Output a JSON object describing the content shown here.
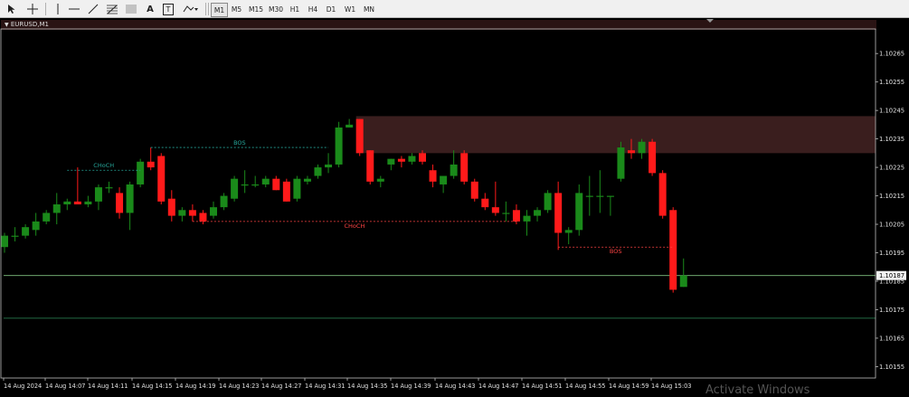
{
  "toolbar": {
    "tools": [
      "cursor-icon",
      "crosshair-icon",
      "vertical-line-icon",
      "horizontal-line-icon",
      "trendline-icon",
      "fibonacci-icon",
      "fib-channel-icon",
      "text-label-icon",
      "text-box-icon",
      "shapes-dropdown-icon"
    ],
    "labels": {
      "text_tool": "A",
      "text_box": "T"
    },
    "timeframes": [
      "M1",
      "M5",
      "M15",
      "M30",
      "H1",
      "H4",
      "D1",
      "W1",
      "MN"
    ]
  },
  "chart": {
    "symbol": "EURUSD,M1",
    "current_price": "1.10187",
    "watermark": "Activate Windows",
    "colors": {
      "bull": "#1a8a1a",
      "bear": "#ff1a1a",
      "zone": "#3a1e1e",
      "header": "#2a1414",
      "axis": "#c0c0c0",
      "price_line": "#7fbf7f",
      "choch_bull": "#26a69a",
      "choch_bear": "#ff4444"
    }
  },
  "chart_data": {
    "type": "candlestick",
    "y_ticks": [
      "1.10265",
      "1.10255",
      "1.10245",
      "1.10235",
      "1.10225",
      "1.10215",
      "1.10205",
      "1.10195",
      "1.10185",
      "1.10175",
      "1.10165",
      "1.10155"
    ],
    "x_ticks": [
      "14 Aug 2024",
      "14 Aug 14:07",
      "14 Aug 14:11",
      "14 Aug 14:15",
      "14 Aug 14:19",
      "14 Aug 14:23",
      "14 Aug 14:27",
      "14 Aug 14:31",
      "14 Aug 14:35",
      "14 Aug 14:39",
      "14 Aug 14:43",
      "14 Aug 14:47",
      "14 Aug 14:51",
      "14 Aug 14:55",
      "14 Aug 14:59",
      "14 Aug 15:03"
    ],
    "ylim": [
      1.10151,
      1.10273
    ],
    "candles": [
      {
        "o": 1.10197,
        "h": 1.10202,
        "l": 1.10195,
        "c": 1.10201
      },
      {
        "o": 1.10201,
        "h": 1.10204,
        "l": 1.10199,
        "c": 1.10201
      },
      {
        "o": 1.10201,
        "h": 1.10205,
        "l": 1.102,
        "c": 1.10204
      },
      {
        "o": 1.10203,
        "h": 1.10209,
        "l": 1.10201,
        "c": 1.10206
      },
      {
        "o": 1.10206,
        "h": 1.1021,
        "l": 1.10205,
        "c": 1.10209
      },
      {
        "o": 1.10209,
        "h": 1.10216,
        "l": 1.10205,
        "c": 1.10212
      },
      {
        "o": 1.10212,
        "h": 1.10214,
        "l": 1.1021,
        "c": 1.10213
      },
      {
        "o": 1.10213,
        "h": 1.10225,
        "l": 1.10212,
        "c": 1.10212
      },
      {
        "o": 1.10212,
        "h": 1.10215,
        "l": 1.10211,
        "c": 1.10213
      },
      {
        "o": 1.10213,
        "h": 1.10219,
        "l": 1.1021,
        "c": 1.10218
      },
      {
        "o": 1.10218,
        "h": 1.1022,
        "l": 1.10216,
        "c": 1.10218
      },
      {
        "o": 1.10216,
        "h": 1.10218,
        "l": 1.10207,
        "c": 1.10209
      },
      {
        "o": 1.10209,
        "h": 1.1022,
        "l": 1.10203,
        "c": 1.10219
      },
      {
        "o": 1.10219,
        "h": 1.10228,
        "l": 1.10218,
        "c": 1.10227
      },
      {
        "o": 1.10227,
        "h": 1.10232,
        "l": 1.10224,
        "c": 1.10225
      },
      {
        "o": 1.10229,
        "h": 1.1023,
        "l": 1.10212,
        "c": 1.10213
      },
      {
        "o": 1.10214,
        "h": 1.10217,
        "l": 1.10206,
        "c": 1.10208
      },
      {
        "o": 1.10208,
        "h": 1.10211,
        "l": 1.10206,
        "c": 1.1021
      },
      {
        "o": 1.1021,
        "h": 1.10212,
        "l": 1.10206,
        "c": 1.10208
      },
      {
        "o": 1.10209,
        "h": 1.1021,
        "l": 1.10205,
        "c": 1.10206
      },
      {
        "o": 1.10208,
        "h": 1.10213,
        "l": 1.10207,
        "c": 1.10211
      },
      {
        "o": 1.10211,
        "h": 1.10216,
        "l": 1.1021,
        "c": 1.10215
      },
      {
        "o": 1.10214,
        "h": 1.10222,
        "l": 1.10213,
        "c": 1.10221
      },
      {
        "o": 1.10219,
        "h": 1.10224,
        "l": 1.10216,
        "c": 1.10219
      },
      {
        "o": 1.10219,
        "h": 1.10222,
        "l": 1.10218,
        "c": 1.10219
      },
      {
        "o": 1.10219,
        "h": 1.10222,
        "l": 1.10218,
        "c": 1.10221
      },
      {
        "o": 1.10221,
        "h": 1.10222,
        "l": 1.10217,
        "c": 1.10217
      },
      {
        "o": 1.1022,
        "h": 1.10221,
        "l": 1.10213,
        "c": 1.10213
      },
      {
        "o": 1.10214,
        "h": 1.10222,
        "l": 1.10213,
        "c": 1.10221
      },
      {
        "o": 1.1022,
        "h": 1.10222,
        "l": 1.10219,
        "c": 1.10221
      },
      {
        "o": 1.10222,
        "h": 1.10226,
        "l": 1.10221,
        "c": 1.10225
      },
      {
        "o": 1.10225,
        "h": 1.1023,
        "l": 1.10223,
        "c": 1.10226
      },
      {
        "o": 1.10226,
        "h": 1.10241,
        "l": 1.10225,
        "c": 1.10239
      },
      {
        "o": 1.10239,
        "h": 1.10242,
        "l": 1.10239,
        "c": 1.1024
      },
      {
        "o": 1.10242,
        "h": 1.10242,
        "l": 1.10229,
        "c": 1.1023
      },
      {
        "o": 1.10231,
        "h": 1.10231,
        "l": 1.10219,
        "c": 1.1022
      },
      {
        "o": 1.1022,
        "h": 1.10222,
        "l": 1.10218,
        "c": 1.10221
      },
      {
        "o": 1.10226,
        "h": 1.10228,
        "l": 1.10224,
        "c": 1.10228
      },
      {
        "o": 1.10228,
        "h": 1.10229,
        "l": 1.10225,
        "c": 1.10227
      },
      {
        "o": 1.10227,
        "h": 1.1023,
        "l": 1.10226,
        "c": 1.10229
      },
      {
        "o": 1.1023,
        "h": 1.10231,
        "l": 1.10226,
        "c": 1.10227
      },
      {
        "o": 1.10224,
        "h": 1.10226,
        "l": 1.10218,
        "c": 1.1022
      },
      {
        "o": 1.10219,
        "h": 1.10221,
        "l": 1.10216,
        "c": 1.10222
      },
      {
        "o": 1.10222,
        "h": 1.10231,
        "l": 1.10221,
        "c": 1.10226
      },
      {
        "o": 1.1023,
        "h": 1.10231,
        "l": 1.10219,
        "c": 1.1022
      },
      {
        "o": 1.1022,
        "h": 1.10221,
        "l": 1.10213,
        "c": 1.10214
      },
      {
        "o": 1.10214,
        "h": 1.10216,
        "l": 1.1021,
        "c": 1.10211
      },
      {
        "o": 1.10211,
        "h": 1.1022,
        "l": 1.10208,
        "c": 1.10209
      },
      {
        "o": 1.10209,
        "h": 1.10213,
        "l": 1.10206,
        "c": 1.10209
      },
      {
        "o": 1.1021,
        "h": 1.10212,
        "l": 1.10205,
        "c": 1.10206
      },
      {
        "o": 1.10206,
        "h": 1.1021,
        "l": 1.10201,
        "c": 1.10208
      },
      {
        "o": 1.10208,
        "h": 1.10211,
        "l": 1.10206,
        "c": 1.1021
      },
      {
        "o": 1.1021,
        "h": 1.10217,
        "l": 1.10209,
        "c": 1.10216
      },
      {
        "o": 1.10216,
        "h": 1.1022,
        "l": 1.10196,
        "c": 1.10202
      },
      {
        "o": 1.10202,
        "h": 1.10204,
        "l": 1.10198,
        "c": 1.10203
      },
      {
        "o": 1.10203,
        "h": 1.10219,
        "l": 1.10201,
        "c": 1.10216
      },
      {
        "o": 1.10215,
        "h": 1.10222,
        "l": 1.10208,
        "c": 1.10215
      },
      {
        "o": 1.10215,
        "h": 1.10224,
        "l": 1.10209,
        "c": 1.10215
      },
      {
        "o": 1.10215,
        "h": 1.10215,
        "l": 1.10208,
        "c": 1.10215
      },
      {
        "o": 1.10221,
        "h": 1.10234,
        "l": 1.1022,
        "c": 1.10232
      },
      {
        "o": 1.10231,
        "h": 1.10235,
        "l": 1.10228,
        "c": 1.1023
      },
      {
        "o": 1.1023,
        "h": 1.10235,
        "l": 1.10228,
        "c": 1.10234
      },
      {
        "o": 1.10234,
        "h": 1.10235,
        "l": 1.10222,
        "c": 1.10223
      },
      {
        "o": 1.10223,
        "h": 1.10224,
        "l": 1.10207,
        "c": 1.10208
      },
      {
        "o": 1.1021,
        "h": 1.10211,
        "l": 1.10181,
        "c": 1.10182
      },
      {
        "o": 1.10183,
        "h": 1.10193,
        "l": 1.10183,
        "c": 1.10187
      }
    ],
    "zone": {
      "from_index": 34,
      "high": 1.10243,
      "low": 1.1023
    },
    "annotations": [
      {
        "label": "CHoCH",
        "kind": "bull",
        "from_index": 6,
        "to_index": 13,
        "price": 1.10224
      },
      {
        "label": "BOS",
        "kind": "bull",
        "from_index": 14,
        "to_index": 31,
        "price": 1.10232
      },
      {
        "label": "CHoCH",
        "kind": "bear",
        "from_index": 18,
        "to_index": 49,
        "price": 1.10206
      },
      {
        "label": "BOS",
        "kind": "bear",
        "from_index": 53,
        "to_index": 64,
        "price": 1.10197
      }
    ],
    "horizontal_lines": [
      {
        "price": 1.10187,
        "color": "#7fbf7f"
      },
      {
        "price": 1.10172,
        "color": "#2e8b57"
      }
    ]
  }
}
